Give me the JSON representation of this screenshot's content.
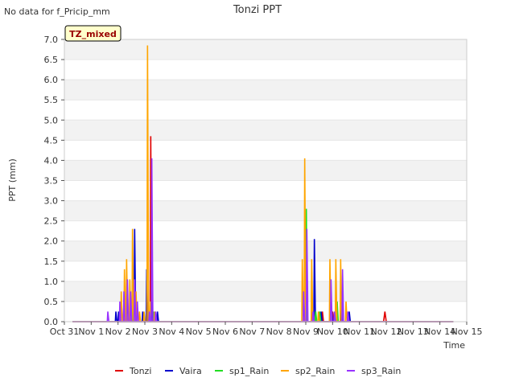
{
  "page": {
    "note": "No data for f_Pricip_mm",
    "badge": "TZ_mixed"
  },
  "chart_data": {
    "type": "line",
    "title": "Tonzi PPT",
    "xlabel": "Time",
    "ylabel": "PPT (mm)",
    "x_unit": "days since Oct 31",
    "xlim": [
      0,
      15
    ],
    "ylim": [
      0,
      7
    ],
    "x_ticks": [
      {
        "x": 0,
        "label": "Oct 31"
      },
      {
        "x": 1,
        "label": "Nov 1"
      },
      {
        "x": 2,
        "label": "Nov 2"
      },
      {
        "x": 3,
        "label": "Nov 3"
      },
      {
        "x": 4,
        "label": "Nov 4"
      },
      {
        "x": 5,
        "label": "Nov 5"
      },
      {
        "x": 6,
        "label": "Nov 6"
      },
      {
        "x": 7,
        "label": "Nov 7"
      },
      {
        "x": 8,
        "label": "Nov 8"
      },
      {
        "x": 9,
        "label": "Nov 9"
      },
      {
        "x": 10,
        "label": "Nov 10"
      },
      {
        "x": 11,
        "label": "Nov 11"
      },
      {
        "x": 12,
        "label": "Nov 12"
      },
      {
        "x": 13,
        "label": "Nov 13"
      },
      {
        "x": 14,
        "label": "Nov 14"
      },
      {
        "x": 15,
        "label": "Nov 15"
      }
    ],
    "y_ticks": [
      {
        "y": 0,
        "label": "0.0"
      },
      {
        "y": 0.5,
        "label": "0.5"
      },
      {
        "y": 1,
        "label": "1.0"
      },
      {
        "y": 1.5,
        "label": "1.5"
      },
      {
        "y": 2,
        "label": "2.0"
      },
      {
        "y": 2.5,
        "label": "2.5"
      },
      {
        "y": 3,
        "label": "3.0"
      },
      {
        "y": 3.5,
        "label": "3.5"
      },
      {
        "y": 4,
        "label": "4.0"
      },
      {
        "y": 4.5,
        "label": "4.5"
      },
      {
        "y": 5,
        "label": "5.0"
      },
      {
        "y": 5.5,
        "label": "5.5"
      },
      {
        "y": 6,
        "label": "6.0"
      },
      {
        "y": 6.5,
        "label": "6.5"
      },
      {
        "y": 7,
        "label": "7.0"
      }
    ],
    "grid": "horizontal bands",
    "legend_position": "bottom",
    "series": [
      {
        "name": "Tonzi",
        "color": "#e00000",
        "points": [
          [
            0.3,
            0
          ],
          [
            3.1,
            0
          ],
          [
            3.12,
            0.25
          ],
          [
            3.15,
            0
          ],
          [
            3.2,
            0
          ],
          [
            3.22,
            4.6
          ],
          [
            3.26,
            0
          ],
          [
            9.2,
            0
          ],
          [
            9.22,
            0.25
          ],
          [
            9.26,
            0
          ],
          [
            9.6,
            0
          ],
          [
            9.62,
            0.25
          ],
          [
            9.66,
            0
          ],
          [
            9.95,
            0
          ],
          [
            10.0,
            0.25
          ],
          [
            10.05,
            0
          ],
          [
            11.9,
            0
          ],
          [
            11.95,
            0.25
          ],
          [
            12.0,
            0
          ],
          [
            14.5,
            0
          ]
        ]
      },
      {
        "name": "Vaira",
        "color": "#0000cc",
        "points": [
          [
            0.3,
            0
          ],
          [
            1.9,
            0
          ],
          [
            1.92,
            0.25
          ],
          [
            1.96,
            0
          ],
          [
            2.0,
            0
          ],
          [
            2.02,
            0.25
          ],
          [
            2.06,
            0
          ],
          [
            2.2,
            0
          ],
          [
            2.22,
            0.5
          ],
          [
            2.26,
            0
          ],
          [
            2.6,
            0
          ],
          [
            2.62,
            2.3
          ],
          [
            2.66,
            0
          ],
          [
            2.9,
            0
          ],
          [
            2.92,
            0.25
          ],
          [
            2.96,
            0
          ],
          [
            3.05,
            0
          ],
          [
            3.07,
            1.3
          ],
          [
            3.11,
            0
          ],
          [
            3.25,
            0
          ],
          [
            3.27,
            0.5
          ],
          [
            3.31,
            0
          ],
          [
            3.45,
            0
          ],
          [
            3.47,
            0.25
          ],
          [
            3.51,
            0
          ],
          [
            9.0,
            0
          ],
          [
            9.02,
            0.25
          ],
          [
            9.06,
            0
          ],
          [
            9.3,
            0
          ],
          [
            9.32,
            2.05
          ],
          [
            9.36,
            0
          ],
          [
            9.55,
            0
          ],
          [
            9.57,
            0.25
          ],
          [
            9.61,
            0
          ],
          [
            9.95,
            0
          ],
          [
            9.97,
            0.25
          ],
          [
            10.01,
            0
          ],
          [
            10.3,
            0
          ],
          [
            10.32,
            0.75
          ],
          [
            10.36,
            0
          ],
          [
            10.6,
            0
          ],
          [
            10.62,
            0.25
          ],
          [
            10.66,
            0
          ],
          [
            14.5,
            0
          ]
        ]
      },
      {
        "name": "sp1_Rain",
        "color": "#22dd22",
        "points": [
          [
            0.3,
            0
          ],
          [
            2.4,
            0
          ],
          [
            2.42,
            0.25
          ],
          [
            2.46,
            0
          ],
          [
            2.55,
            0
          ],
          [
            2.57,
            0.5
          ],
          [
            2.61,
            0
          ],
          [
            3.3,
            0
          ],
          [
            3.32,
            0.25
          ],
          [
            3.36,
            0
          ],
          [
            9.0,
            0
          ],
          [
            9.02,
            2.8
          ],
          [
            9.06,
            0
          ],
          [
            9.35,
            0
          ],
          [
            9.37,
            0.25
          ],
          [
            9.41,
            0
          ],
          [
            9.5,
            0
          ],
          [
            9.52,
            0.25
          ],
          [
            9.56,
            0
          ],
          [
            9.9,
            0
          ],
          [
            9.92,
            0.75
          ],
          [
            9.96,
            0
          ],
          [
            10.15,
            0
          ],
          [
            10.17,
            0.5
          ],
          [
            10.21,
            0
          ],
          [
            14.5,
            0
          ]
        ]
      },
      {
        "name": "sp2_Rain",
        "color": "#ffa500",
        "points": [
          [
            0.3,
            0
          ],
          [
            2.1,
            0
          ],
          [
            2.12,
            0.75
          ],
          [
            2.16,
            0
          ],
          [
            2.22,
            0
          ],
          [
            2.24,
            1.3
          ],
          [
            2.28,
            0
          ],
          [
            2.3,
            0
          ],
          [
            2.32,
            1.55
          ],
          [
            2.36,
            0
          ],
          [
            2.42,
            0
          ],
          [
            2.44,
            1.05
          ],
          [
            2.48,
            0
          ],
          [
            2.52,
            0
          ],
          [
            2.54,
            2.3
          ],
          [
            2.58,
            0
          ],
          [
            2.65,
            0
          ],
          [
            2.67,
            0.75
          ],
          [
            2.71,
            0
          ],
          [
            2.78,
            0
          ],
          [
            2.8,
            0.25
          ],
          [
            2.84,
            0
          ],
          [
            2.95,
            0
          ],
          [
            2.97,
            0.25
          ],
          [
            3.01,
            0
          ],
          [
            3.08,
            0
          ],
          [
            3.1,
            6.85
          ],
          [
            3.14,
            0
          ],
          [
            3.18,
            0
          ],
          [
            3.2,
            0.5
          ],
          [
            3.24,
            0
          ],
          [
            3.35,
            0
          ],
          [
            3.37,
            0.25
          ],
          [
            3.41,
            0
          ],
          [
            8.85,
            0
          ],
          [
            8.87,
            1.55
          ],
          [
            8.91,
            0
          ],
          [
            8.94,
            0
          ],
          [
            8.96,
            4.05
          ],
          [
            9.0,
            0
          ],
          [
            9.2,
            0
          ],
          [
            9.22,
            1.55
          ],
          [
            9.26,
            0
          ],
          [
            9.45,
            0
          ],
          [
            9.47,
            0.25
          ],
          [
            9.51,
            0
          ],
          [
            9.88,
            0
          ],
          [
            9.9,
            1.55
          ],
          [
            9.94,
            0
          ],
          [
            10.1,
            0
          ],
          [
            10.12,
            1.55
          ],
          [
            10.16,
            0
          ],
          [
            10.28,
            0
          ],
          [
            10.3,
            1.55
          ],
          [
            10.34,
            0
          ],
          [
            10.48,
            0
          ],
          [
            10.5,
            0.5
          ],
          [
            10.54,
            0
          ],
          [
            14.5,
            0
          ]
        ]
      },
      {
        "name": "sp3_Rain",
        "color": "#9933ff",
        "points": [
          [
            0.3,
            0
          ],
          [
            1.6,
            0
          ],
          [
            1.62,
            0.25
          ],
          [
            1.66,
            0
          ],
          [
            2.05,
            0
          ],
          [
            2.07,
            0.5
          ],
          [
            2.11,
            0
          ],
          [
            2.2,
            0
          ],
          [
            2.22,
            0.75
          ],
          [
            2.26,
            0
          ],
          [
            2.33,
            0
          ],
          [
            2.35,
            1.05
          ],
          [
            2.39,
            0
          ],
          [
            2.45,
            0
          ],
          [
            2.47,
            0.75
          ],
          [
            2.51,
            0
          ],
          [
            2.6,
            0
          ],
          [
            2.62,
            1.05
          ],
          [
            2.66,
            0
          ],
          [
            2.7,
            0
          ],
          [
            2.72,
            0.5
          ],
          [
            2.76,
            0
          ],
          [
            3.15,
            0
          ],
          [
            3.17,
            0.25
          ],
          [
            3.21,
            0
          ],
          [
            3.24,
            0
          ],
          [
            3.26,
            4.05
          ],
          [
            3.3,
            0
          ],
          [
            3.38,
            0
          ],
          [
            3.4,
            0.25
          ],
          [
            3.44,
            0
          ],
          [
            8.9,
            0
          ],
          [
            8.92,
            0.75
          ],
          [
            8.96,
            0
          ],
          [
            9.02,
            0
          ],
          [
            9.04,
            2.3
          ],
          [
            9.08,
            0
          ],
          [
            9.25,
            0
          ],
          [
            9.27,
            0.25
          ],
          [
            9.31,
            0
          ],
          [
            9.92,
            0
          ],
          [
            9.94,
            1.05
          ],
          [
            9.98,
            0
          ],
          [
            10.05,
            0
          ],
          [
            10.07,
            0.25
          ],
          [
            10.11,
            0
          ],
          [
            10.35,
            0
          ],
          [
            10.37,
            1.3
          ],
          [
            10.41,
            0
          ],
          [
            10.55,
            0
          ],
          [
            10.57,
            0.25
          ],
          [
            10.61,
            0
          ],
          [
            14.5,
            0
          ]
        ]
      }
    ]
  }
}
